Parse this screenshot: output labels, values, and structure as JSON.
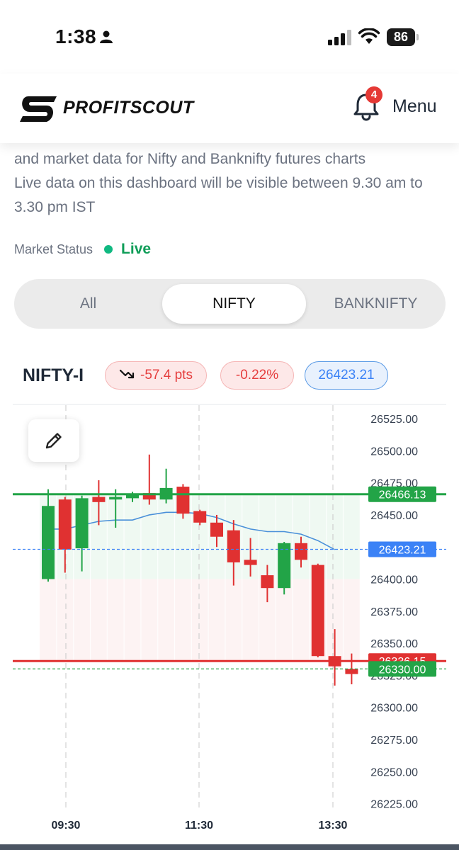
{
  "status_bar": {
    "time": "1:38",
    "battery": "86"
  },
  "header": {
    "logo_text": "PROFITSCOUT",
    "notifications_count": "4",
    "menu_label": "Menu"
  },
  "intro": {
    "line1": "and market data for Nifty and Banknifty futures charts",
    "line2": "Live data on this dashboard will be visible between 9.30 am to 3.30 pm IST"
  },
  "market_status": {
    "label": "Market Status",
    "value": "Live"
  },
  "tabs": [
    {
      "label": "All",
      "active": false
    },
    {
      "label": "NIFTY",
      "active": true
    },
    {
      "label": "BANKNIFTY",
      "active": false
    }
  ],
  "symbol": {
    "name": "NIFTY-I",
    "change_pts": "-57.4 pts",
    "change_pct": "-0.22%",
    "price": "26423.21"
  },
  "colors": {
    "up": "#22a447",
    "down": "#e03131",
    "ma": "#4a90d9",
    "price_line": "#3b82f6"
  },
  "chart_data": {
    "type": "candlestick",
    "x_ticks": [
      "09:30",
      "11:30",
      "13:30"
    ],
    "y_ticks": [
      "26525.00",
      "26500.00",
      "26475.00",
      "26450.00",
      "26425.00",
      "26400.00",
      "26375.00",
      "26350.00",
      "26325.00",
      "26300.00",
      "26275.00",
      "26250.00",
      "26225.00"
    ],
    "ylim": [
      26222,
      26530
    ],
    "candles": [
      {
        "open": 26400,
        "high": 26470,
        "low": 26398,
        "close": 26457
      },
      {
        "open": 26462,
        "high": 26464,
        "low": 26405,
        "close": 26423
      },
      {
        "open": 26424,
        "high": 26465,
        "low": 26406,
        "close": 26463
      },
      {
        "open": 26464,
        "high": 26477,
        "low": 26442,
        "close": 26460
      },
      {
        "open": 26462,
        "high": 26470,
        "low": 26440,
        "close": 26464
      },
      {
        "open": 26463,
        "high": 26468,
        "low": 26460,
        "close": 26466
      },
      {
        "open": 26467,
        "high": 26497,
        "low": 26458,
        "close": 26462
      },
      {
        "open": 26462,
        "high": 26486,
        "low": 26459,
        "close": 26471
      },
      {
        "open": 26472,
        "high": 26474,
        "low": 26447,
        "close": 26451
      },
      {
        "open": 26453,
        "high": 26454,
        "low": 26442,
        "close": 26444
      },
      {
        "open": 26444,
        "high": 26450,
        "low": 26425,
        "close": 26433
      },
      {
        "open": 26438,
        "high": 26446,
        "low": 26395,
        "close": 26413
      },
      {
        "open": 26415,
        "high": 26432,
        "low": 26402,
        "close": 26411
      },
      {
        "open": 26403,
        "high": 26411,
        "low": 26382,
        "close": 26393
      },
      {
        "open": 26393,
        "high": 26429,
        "low": 26388,
        "close": 26428
      },
      {
        "open": 26428,
        "high": 26433,
        "low": 26409,
        "close": 26415
      },
      {
        "open": 26411,
        "high": 26412,
        "low": 26339,
        "close": 26340
      },
      {
        "open": 26340,
        "high": 26361,
        "low": 26317,
        "close": 26332
      },
      {
        "open": 26330,
        "high": 26342,
        "low": 26318,
        "close": 26326
      }
    ],
    "moving_average": [
      26439,
      26439,
      26442,
      26445,
      26446,
      26446,
      26450,
      26452,
      26452,
      26451,
      26448,
      26443,
      26439,
      26437,
      26437,
      26435,
      26430,
      26423
    ],
    "levels": [
      {
        "value": 26466.13,
        "label": "26466.13",
        "color": "#22a447",
        "style": "solid"
      },
      {
        "value": 26423.21,
        "label": "26423.21",
        "color": "#3b82f6",
        "style": "dashed"
      },
      {
        "value": 26336.15,
        "label": "26336.15",
        "color": "#e03131",
        "style": "solid"
      },
      {
        "value": 26330.0,
        "label": "26330.00",
        "color": "#22a447",
        "style": "dashed"
      }
    ]
  }
}
